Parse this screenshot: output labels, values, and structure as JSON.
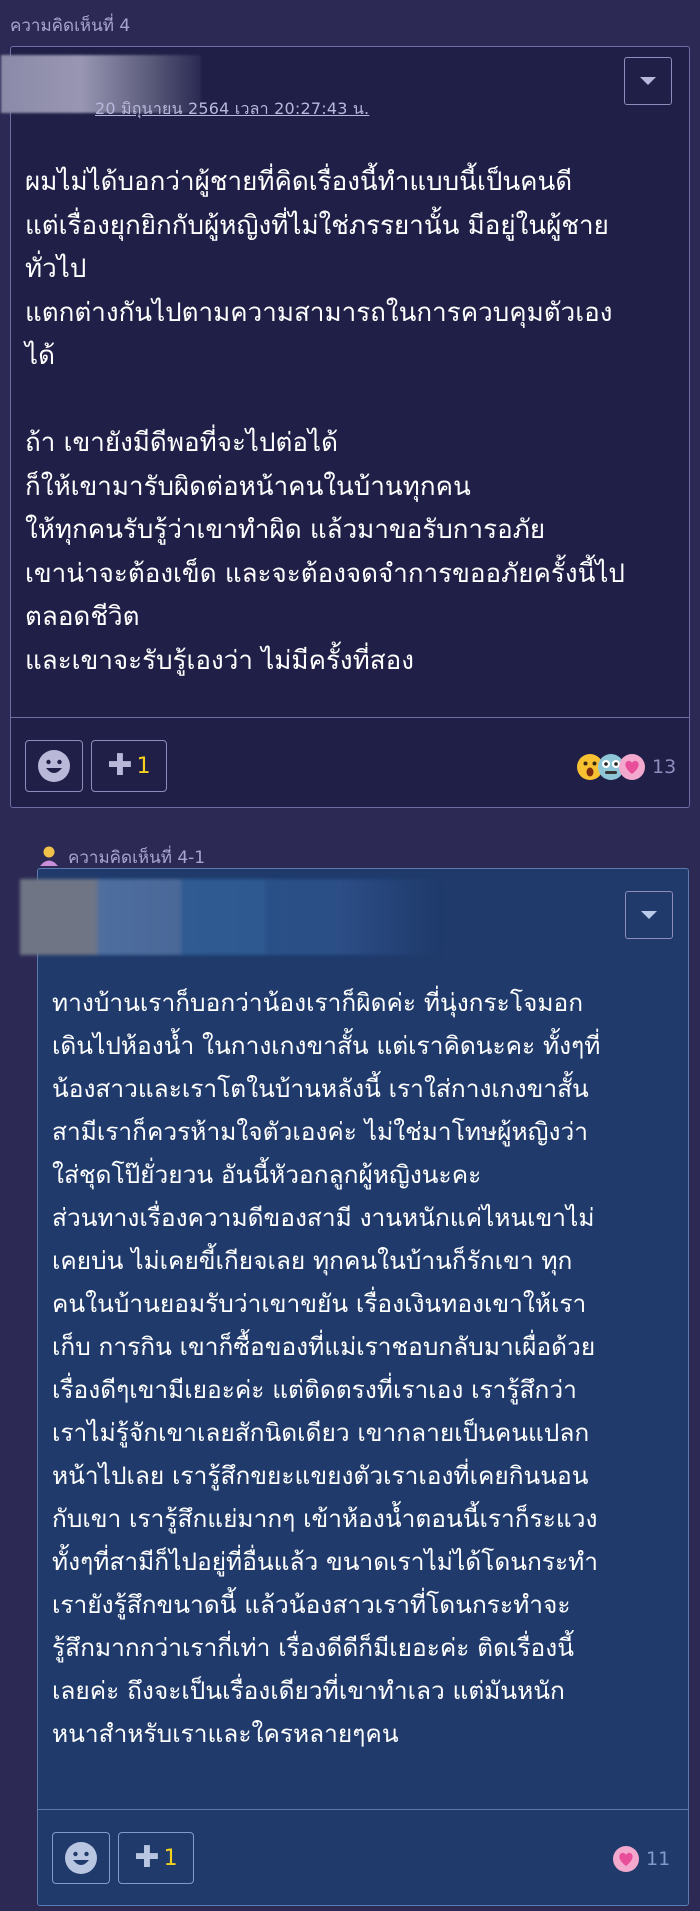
{
  "comment": {
    "label": "ความคิดเห็นที่ 4",
    "timestamp": "20 มิถุนายน 2564 เวลา 20:27:43 น.",
    "body": "ผมไม่ได้บอกว่าผู้ชายที่คิดเรื่องนี้ทำแบบนี้เป็นคนดี\nแต่เรื่องยุกยิกกับผู้หญิงที่ไม่ใช่ภรรยานั้น มีอยู่ในผู้ชาย\nทั่วไป\nแตกต่างกันไปตามความสามารถในการควบคุมตัวเอง\nได้\n\nถ้า เขายังมีดีพอที่จะไปต่อได้\nก็ให้เขามารับผิดต่อหน้าคนในบ้านทุกคน\nให้ทุกคนรับรู้ว่าเขาทำผิด แล้วมาขอรับการอภัย\nเขาน่าจะต้องเข็ด และจะต้องจดจำการขออภัยครั้งนี้ไป\nตลอดชีวิต\nและเขาจะรับรู้เองว่า ไม่มีครั้งที่สอง",
    "plus_count": "1",
    "reaction_count": "13",
    "reaction_icons": [
      "surprised-face-icon",
      "dizzy-face-icon",
      "heart-icon"
    ]
  },
  "reply": {
    "label": "ความคิดเห็นที่ 4-1",
    "body": "ทางบ้านเราก็บอกว่าน้องเราก็ผิดค่ะ ที่นุ่งกระโจมอก\nเดินไปห้องน้ำ ในกางเกงขาสั้น แต่เราคิดนะคะ ทั้งๆที่\nน้องสาวและเราโตในบ้านหลังนี้ เราใส่กางเกงขาสั้น\nสามีเราก็ควรห้ามใจตัวเองค่ะ ไม่ใช่มาโทษผู้หญิงว่า\nใส่ชุดโป๊ยั่วยวน  อันนี้หัวอกลูกผู้หญิงนะคะ\nส่วนทางเรื่องความดีของสามี งานหนักแค่ไหนเขาไม่\nเคยบ่น ไม่เคยขี้เกียจเลย ทุกคนในบ้านก็รักเขา ทุก\nคนในบ้านยอมรับว่าเขาขยัน เรื่องเงินทองเขาให้เรา\nเก็บ การกิน เขาก็ซื้อของที่แม่เราชอบกลับมาเผื่อด้วย\nเรื่องดีๆเขามีเยอะค่ะ แต่ติดตรงที่เราเอง เรารู้สึกว่า\nเราไม่รู้จักเขาเลยสักนิดเดียว เขากลายเป็นคนแปลก\nหน้าไปเลย เรารู้สึกขยะแขยงตัวเราเองที่เคยกินนอน\nกับเขา เรารู้สึกแย่มากๆ เข้าห้องน้ำตอนนี้เราก็ระแวง\nทั้งๆที่สามีก็ไปอยู่ที่อื่นแล้ว ขนาดเราไม่ได้โดนกระทำ\nเรายังรู้สึกขนาดนี้ แล้วน้องสาวเราที่โดนกระทำจะ\nรู้สึกมากกว่าเรากี่เท่า เรื่องดีดีก็มีเยอะค่ะ ติดเรื่องนี้\nเลยค่ะ ถึงจะเป็นเรื่องเดียวที่เขาทำเลว แต่มันหนัก\nหนาสำหรับเราและใครหลายๆคน",
    "plus_count": "1",
    "reaction_count": "11",
    "reaction_icons": [
      "heart-icon"
    ]
  },
  "colors": {
    "background": "#2c2a55",
    "card_main": "#1f1f47",
    "card_reply": "#1f3a6b",
    "plus_count": "#f4d11c",
    "heart": "#e94e9b"
  }
}
